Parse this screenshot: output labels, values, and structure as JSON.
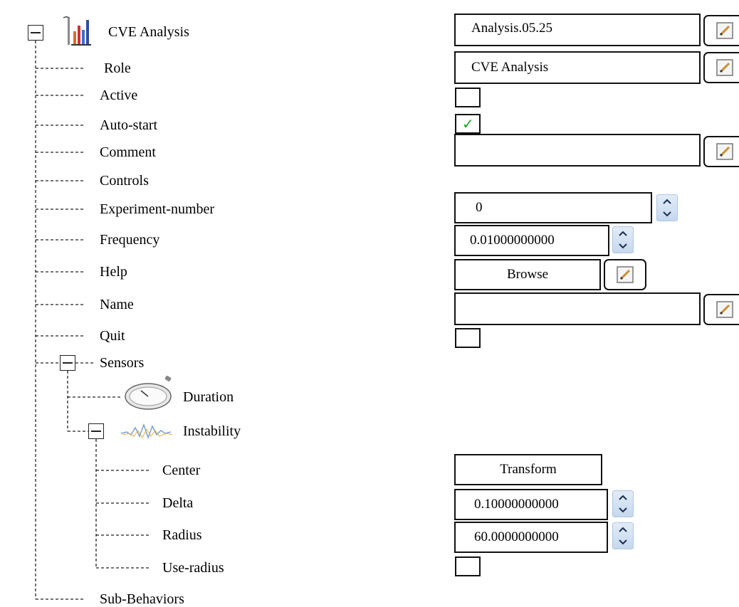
{
  "tree": {
    "root_label": "CVE Analysis",
    "items": {
      "role": "Role",
      "active": "Active",
      "auto_start": "Auto-start",
      "comment": "Comment",
      "controls": "Controls",
      "experiment_number": "Experiment-number",
      "frequency": "Frequency",
      "help": "Help",
      "name": "Name",
      "quit": "Quit",
      "sensors": "Sensors",
      "duration": "Duration",
      "instability": "Instability",
      "center": "Center",
      "delta": "Delta",
      "radius": "Radius",
      "use_radius": "Use-radius",
      "sub_behaviors": "Sub-Behaviors"
    }
  },
  "props": {
    "root_value": "Analysis.05.25",
    "role_value": "CVE Analysis",
    "active_checked": false,
    "auto_start_checked": true,
    "comment_value": "",
    "experiment_number_value": "0",
    "frequency_value": "0.01000000000",
    "help_button_label": "Browse",
    "name_value": "",
    "quit_checked": false,
    "center_button_label": "Transform",
    "delta_value": "0.10000000000",
    "radius_value": "60.0000000000",
    "use_radius_checked": false
  },
  "icons": {
    "expand": "minus-box-icon",
    "edit": "edit-pencil-icon",
    "spin": "spin-updown-icon",
    "analysis": "bar-chart-tool-icon",
    "duration": "stopwatch-icon",
    "instability": "waveform-icon",
    "check": "checkmark-icon"
  },
  "colors": {
    "check": "#1aa01a",
    "spin": "#c6d8ee"
  }
}
